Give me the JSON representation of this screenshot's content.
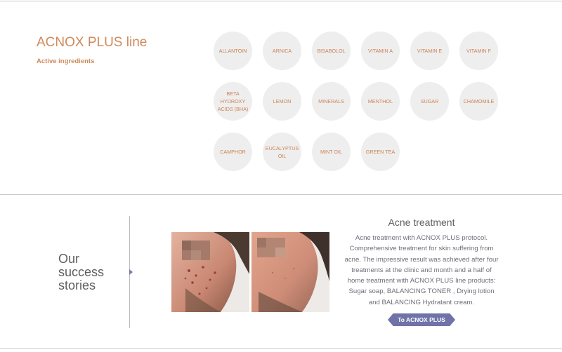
{
  "products": {
    "title": "ACNOX PLUS line",
    "subtitle": "Active ingredients",
    "ingredients": [
      "ALLANTOIN",
      "ARNICA",
      "BISABOLOL",
      "VITAMIN A",
      "VITAMIN E",
      "VITAMIN F",
      "BETA HYDROXY ACIDS (BHA)",
      "LEMON",
      "MINERALS",
      "MENTHOL",
      "SUGAR",
      "CHAMOMILE",
      "CAMPHOR",
      "EUCALYPTUS OIL",
      "MINT OIL",
      "GREEN TEA"
    ]
  },
  "stories": {
    "title": "Our\nsuccess\nstories",
    "case_title": "Acne treatment",
    "case_description": "Acne treatment with ACNOX PLUS protocol. Comprehensive treatment for skin suffering from acne. The impressive result was achieved after four treatments at the clinic and month and a half of home treatment with ACNOX PLUS line products: Sugar soap, BALANCING TONER , Drying lotion and BALANCING Hydratant cream.",
    "cta_label": "To ACNOX PLUS"
  },
  "colors": {
    "accent": "#d08a5b",
    "cta": "#6f73a8",
    "circle": "#eeeeee"
  }
}
